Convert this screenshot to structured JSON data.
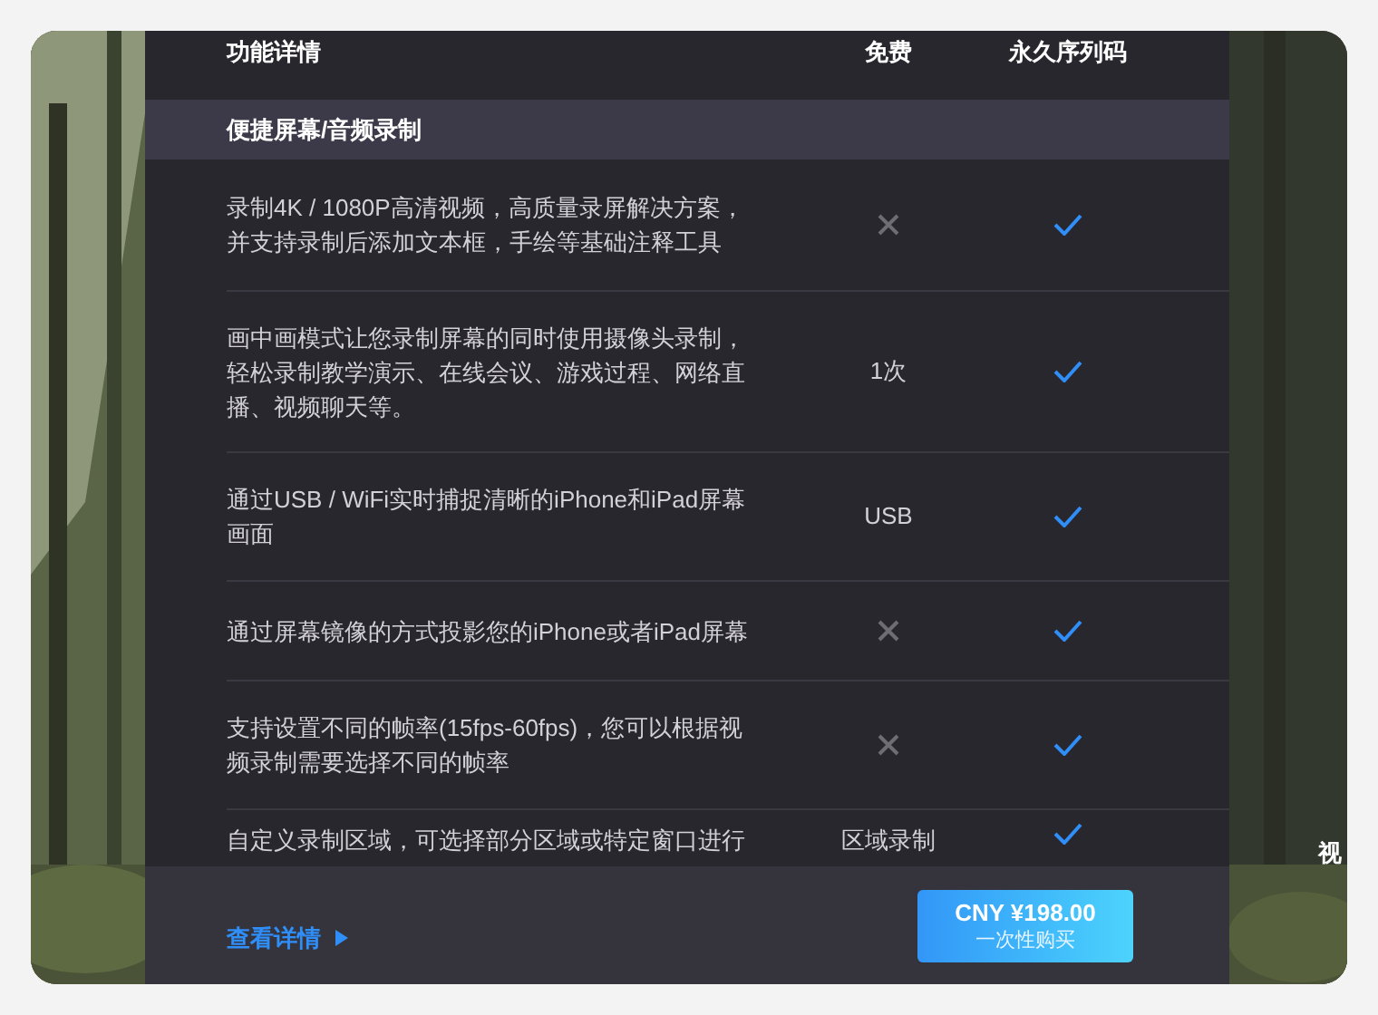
{
  "header": {
    "columns": [
      "功能详情",
      "免费",
      "永久序列码"
    ]
  },
  "section": {
    "title": "便捷屏幕/音频录制"
  },
  "rows": [
    {
      "lines": [
        "录制4K / 1080P高清视频，高质量录屏解决方案，",
        "并支持录制后添加文本框，手绘等基础注释工具"
      ],
      "free": {
        "kind": "cross"
      },
      "license": {
        "kind": "check"
      }
    },
    {
      "lines": [
        "画中画模式让您录制屏幕的同时使用摄像头录制，",
        "轻松录制教学演示、在线会议、游戏过程、网络直",
        "播、视频聊天等。"
      ],
      "free": {
        "kind": "text",
        "text": "1次"
      },
      "license": {
        "kind": "check"
      }
    },
    {
      "lines": [
        "通过USB / WiFi实时捕捉清晰的iPhone和iPad屏幕",
        "画面"
      ],
      "free": {
        "kind": "text",
        "text": "USB"
      },
      "license": {
        "kind": "check"
      }
    },
    {
      "lines": [
        "通过屏幕镜像的方式投影您的iPhone或者iPad屏幕"
      ],
      "free": {
        "kind": "cross"
      },
      "license": {
        "kind": "check"
      }
    },
    {
      "lines": [
        "支持设置不同的帧率(15fps-60fps)，您可以根据视",
        "频录制需要选择不同的帧率"
      ],
      "free": {
        "kind": "cross"
      },
      "license": {
        "kind": "check"
      }
    },
    {
      "lines": [
        "自定义录制区域，可选择部分区域或特定窗口进行"
      ],
      "free": {
        "kind": "text",
        "text": "区域录制"
      },
      "license": {
        "kind": "check"
      }
    }
  ],
  "footer": {
    "details_link": "查看详情",
    "buy_button": {
      "price": "CNY ¥198.00",
      "note": "一次性购买"
    }
  },
  "side_text": "视"
}
